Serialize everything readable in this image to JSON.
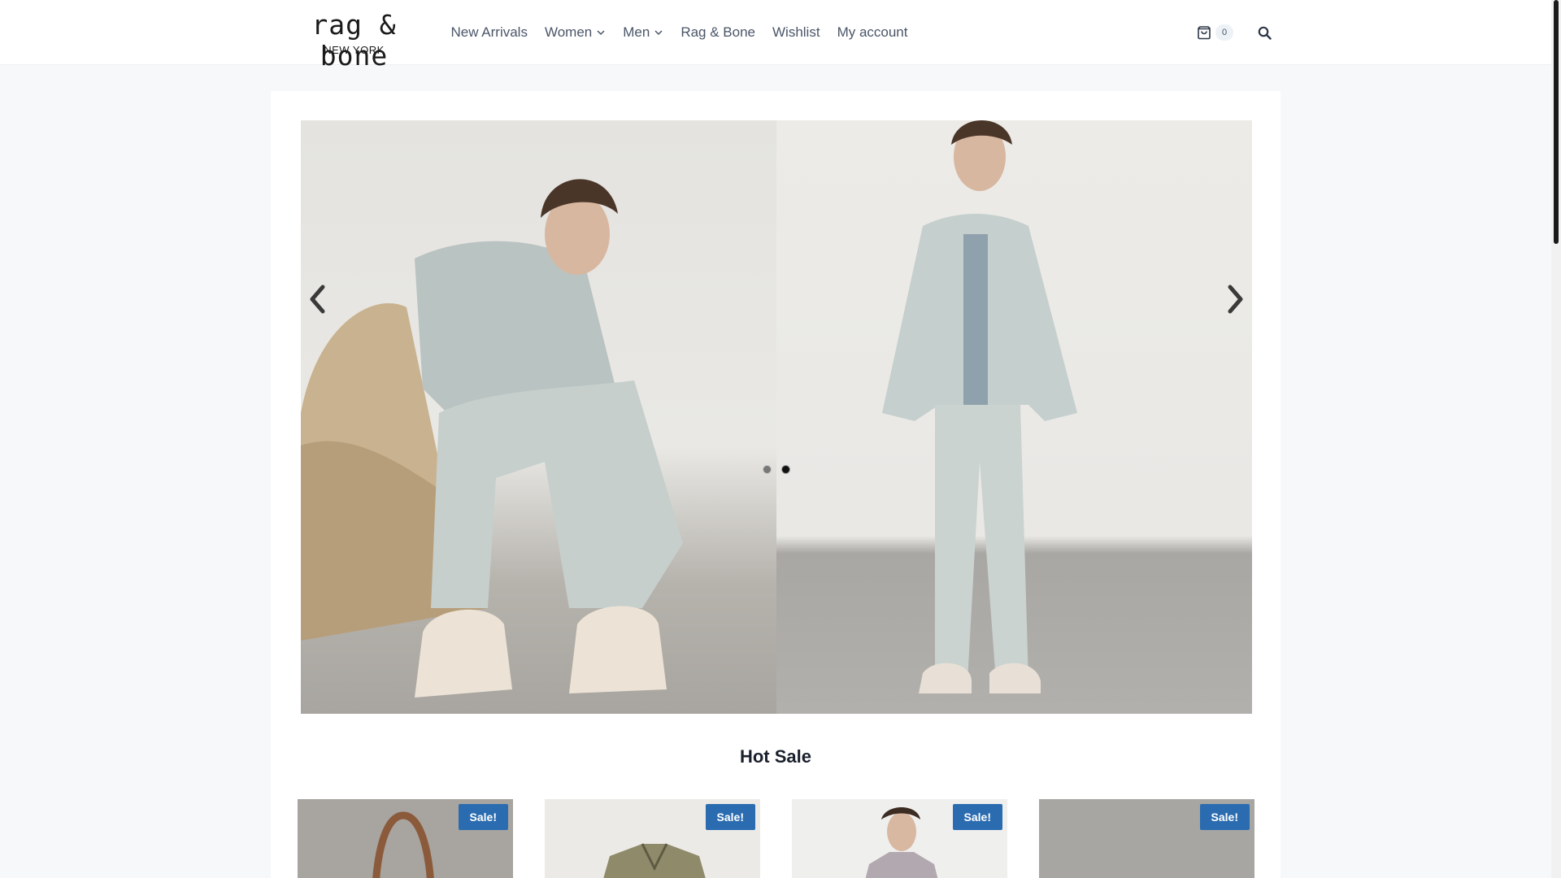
{
  "header": {
    "logo": {
      "main": "rag & bone",
      "sub": "NEW YORK"
    },
    "nav": [
      {
        "label": "New Arrivals",
        "has_dropdown": false
      },
      {
        "label": "Women",
        "has_dropdown": true
      },
      {
        "label": "Men",
        "has_dropdown": true
      },
      {
        "label": "Rag & Bone",
        "has_dropdown": false
      },
      {
        "label": "Wishlist",
        "has_dropdown": false
      },
      {
        "label": "My account",
        "has_dropdown": false
      }
    ],
    "cart": {
      "icon": "shopping-bag-icon",
      "count": "0"
    },
    "search": {
      "icon": "search-icon"
    }
  },
  "slider": {
    "slides": [
      {
        "subject": "model-seated-denim",
        "active": false
      },
      {
        "subject": "model-standing-denim",
        "active": true
      }
    ],
    "prev_icon": "chevron-left-icon",
    "next_icon": "chevron-right-icon",
    "active_index": 1
  },
  "section": {
    "title": "Hot Sale"
  },
  "products": [
    {
      "badge": "Sale!",
      "image": "leather-tote-bag"
    },
    {
      "badge": "Sale!",
      "image": "olive-jacket"
    },
    {
      "badge": "Sale!",
      "image": "grey-hoodie-model"
    },
    {
      "badge": "Sale!",
      "image": "grey-product"
    }
  ],
  "colors": {
    "accent": "#2b6cb0",
    "nav_text": "#4a5568",
    "page_bg": "#f7f8fa"
  }
}
